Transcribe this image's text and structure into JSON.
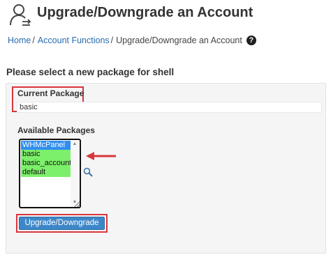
{
  "header": {
    "icon": "user-accounts-icon",
    "title": "Upgrade/Downgrade an Account"
  },
  "breadcrumb": {
    "items": [
      {
        "label": "Home",
        "link": true
      },
      {
        "label": "Account Functions",
        "link": true
      },
      {
        "label": "Upgrade/Downgrade an Account",
        "link": false
      }
    ],
    "separator": "/",
    "help_icon": "question-circle-icon"
  },
  "section": {
    "heading": "Please select a new package for shell"
  },
  "current_package": {
    "label": "Current Package",
    "value": "basic"
  },
  "available_packages": {
    "label": "Available Packages",
    "options": [
      "WHMcPanel",
      "basic",
      "basic_account",
      "default"
    ],
    "selected": "WHMcPanel",
    "highlight_color": "#7cf06a",
    "selected_color": "#2f8ef0"
  },
  "annotation": {
    "arrow_icon": "red-arrow-left-icon",
    "frame_color": "#d9363b"
  },
  "search": {
    "icon": "magnifier-icon"
  },
  "submit": {
    "label": "Upgrade/Downgrade",
    "color": "#3d87c8"
  }
}
